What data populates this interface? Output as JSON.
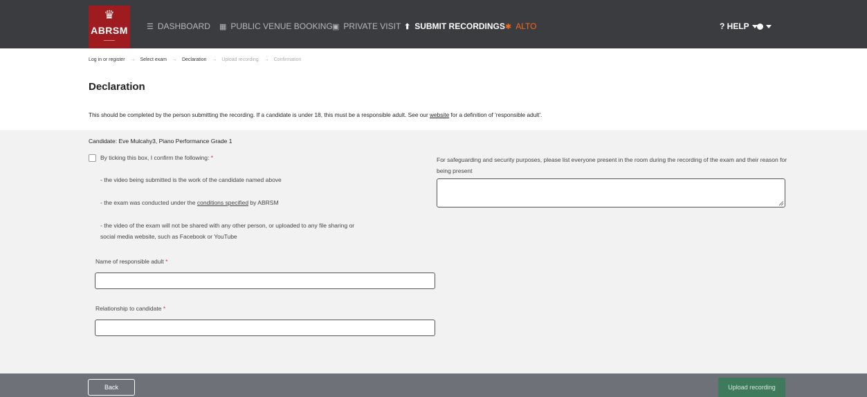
{
  "header": {
    "brand": "ABRSM",
    "nav": [
      {
        "icon": "list-icon",
        "label": "DASHBOARD"
      },
      {
        "icon": "calendar-icon",
        "label": "PUBLIC VENUE BOOKING"
      },
      {
        "icon": "id-card-icon",
        "label": "PRIVATE VISIT"
      },
      {
        "icon": "upload-icon",
        "label": "SUBMIT RECORDINGS"
      },
      {
        "icon": "bug-icon",
        "label": "ALTO"
      }
    ],
    "help_label": "? HELP"
  },
  "breadcrumb": [
    "Log in or register",
    "Select exam",
    "Declaration",
    "Upload recording",
    "Confirmation"
  ],
  "page_title": "Declaration",
  "intro": {
    "before": "This should be completed by the person submitting the recording. If a candidate is under 18, this must be a responsible adult. See our ",
    "link": "website",
    "after": " for a definition of 'responsible adult'."
  },
  "candidate": "Candidate: Eve Mulcahy3, Piano Performance Grade 1",
  "confirm": {
    "label": "By ticking this box, I confirm the following:",
    "required": "*",
    "line1": "- the video being submitted is the work of the candidate named above",
    "line2_before": "- the exam was conducted under the ",
    "line2_link": "conditions specified",
    "line2_after": " by ABRSM",
    "line3a": "- the video of the exam will not be shared with any other person, or uploaded to any file sharing or",
    "line3b": "social media website, such as Facebook or YouTube"
  },
  "fields": {
    "responsible_adult_label": "Name of responsible adult",
    "relationship_label": "Relationship to candidate",
    "safeguarding_label": "For safeguarding and security purposes, please list everyone present in the room during the recording of the exam and their reason for being present"
  },
  "footer": {
    "back_label": "Back",
    "upload_label": "Upload recording"
  },
  "colors": {
    "brand_red": "#9e1b20",
    "nav_bg": "#3b3c3f",
    "alto_orange": "#f26a1b",
    "upload_green": "#3e7a5b"
  }
}
